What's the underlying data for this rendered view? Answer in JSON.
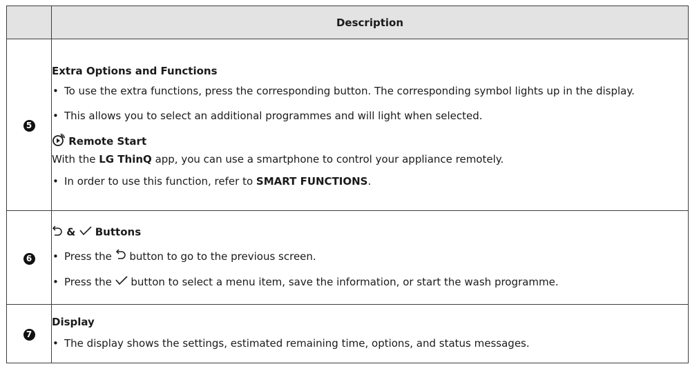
{
  "header": {
    "num": "",
    "description": "Description"
  },
  "rows": [
    {
      "num": "5",
      "title": "Extra Options and Functions",
      "bullet1": "To use the extra functions, press the corresponding button. The corresponding symbol lights up in the display.",
      "bullet2": "This allows you to select an additional programmes and will light when selected.",
      "remote_title": "Remote Start",
      "remote_text_a": "With the ",
      "remote_text_b": "LG ThinQ",
      "remote_text_c": " app, you can use a smartphone to control your appliance remotely.",
      "bullet3_a": "In order to use this function, refer to ",
      "bullet3_b": "SMART FUNCTIONS",
      "bullet3_c": "."
    },
    {
      "num": "6",
      "title_mid": " & ",
      "title_end": " Buttons",
      "bullet1_a": "Press the ",
      "bullet1_b": " button to go to the previous screen.",
      "bullet2_a": "Press the ",
      "bullet2_b": " button to select a menu item, save the information, or start the wash programme."
    },
    {
      "num": "7",
      "title": "Display",
      "bullet1": "The display shows the settings, estimated remaining time, options, and status messages."
    }
  ],
  "icons": {
    "remote": "remote-start-icon",
    "back": "back-arrow-icon",
    "check": "checkmark-icon"
  },
  "bullet": "•"
}
